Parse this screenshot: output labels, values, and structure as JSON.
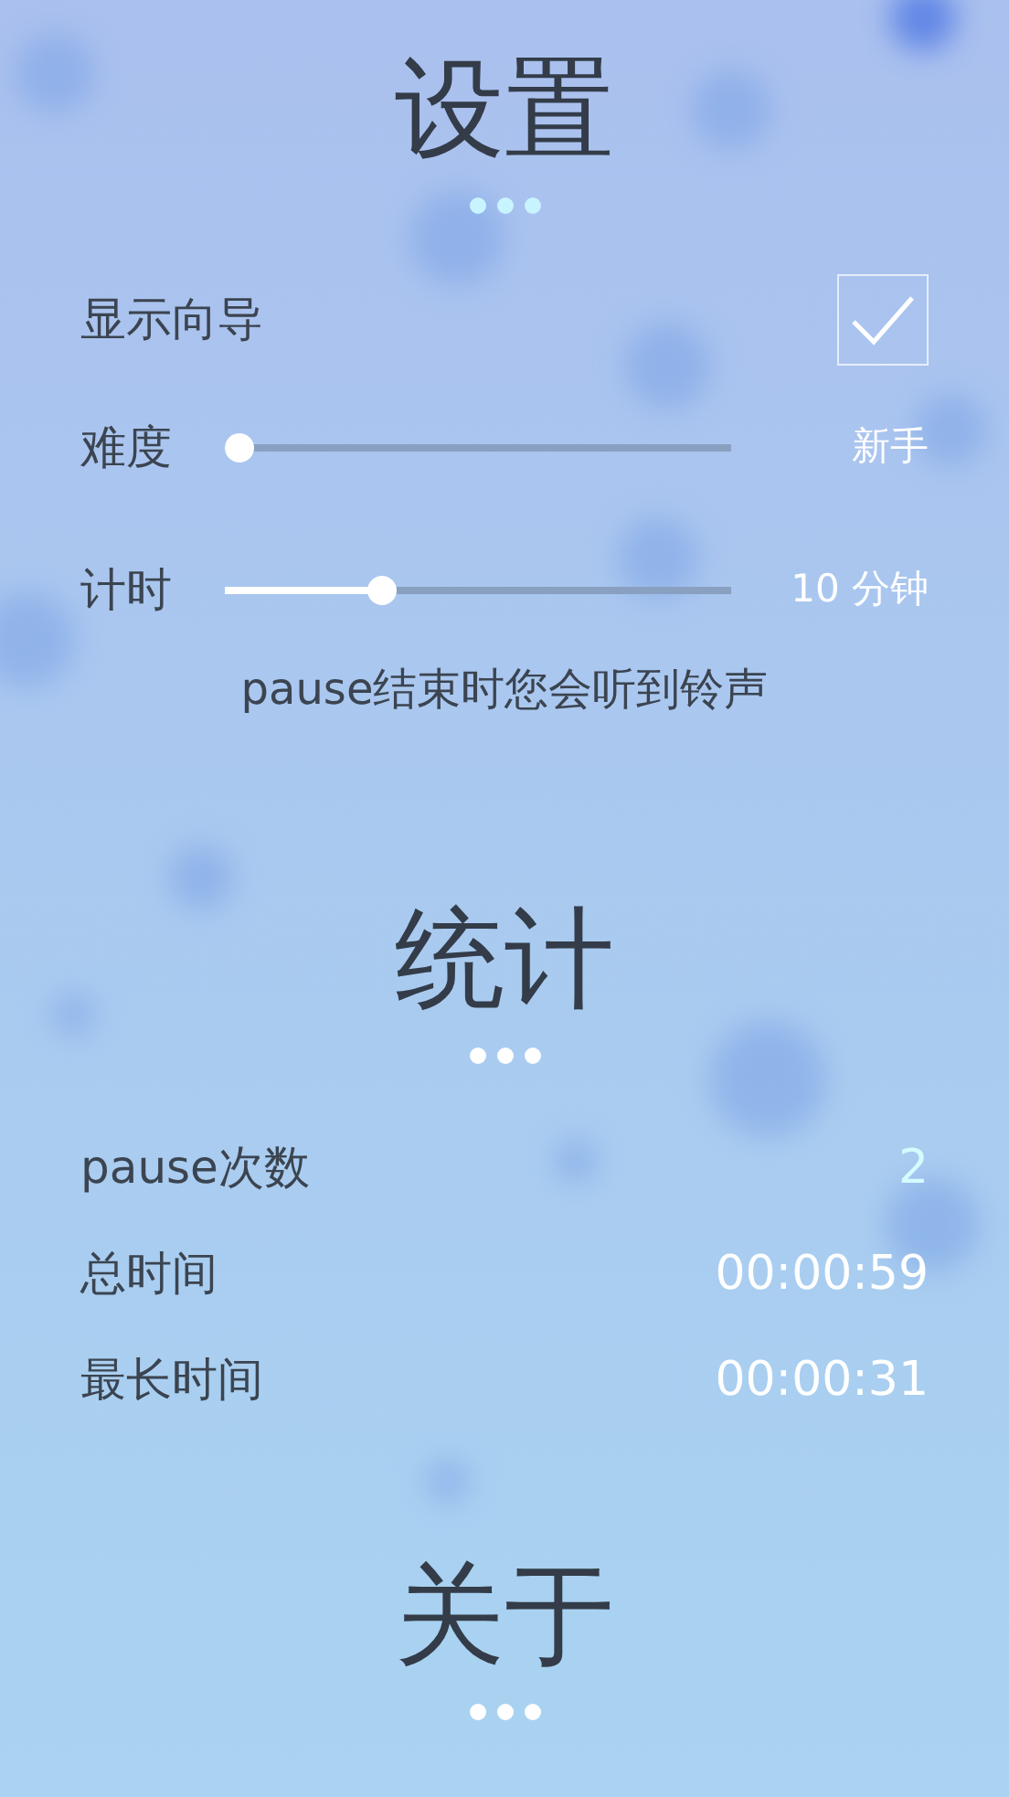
{
  "sections": [
    {
      "title": "设置",
      "items": [
        {
          "kind": "checkbox",
          "label": "显示向导",
          "checked": true
        },
        {
          "kind": "slider",
          "label": "难度",
          "level": 0,
          "reading": "新手"
        },
        {
          "kind": "slider",
          "label": "计时",
          "level": 0.3,
          "reading": "10 分钟"
        },
        {
          "kind": "note",
          "text": "pause结束时您会听到铃声"
        }
      ]
    },
    {
      "title": "统计",
      "items": [
        {
          "kind": "stat",
          "label": "pause次数",
          "value": "2",
          "highlight": true
        },
        {
          "kind": "stat",
          "label": "总时间",
          "value": "00:00:59",
          "highlight": false
        },
        {
          "kind": "stat",
          "label": "最长时间",
          "value": "00:00:31",
          "highlight": false
        }
      ]
    },
    {
      "title": "关于"
    }
  ]
}
